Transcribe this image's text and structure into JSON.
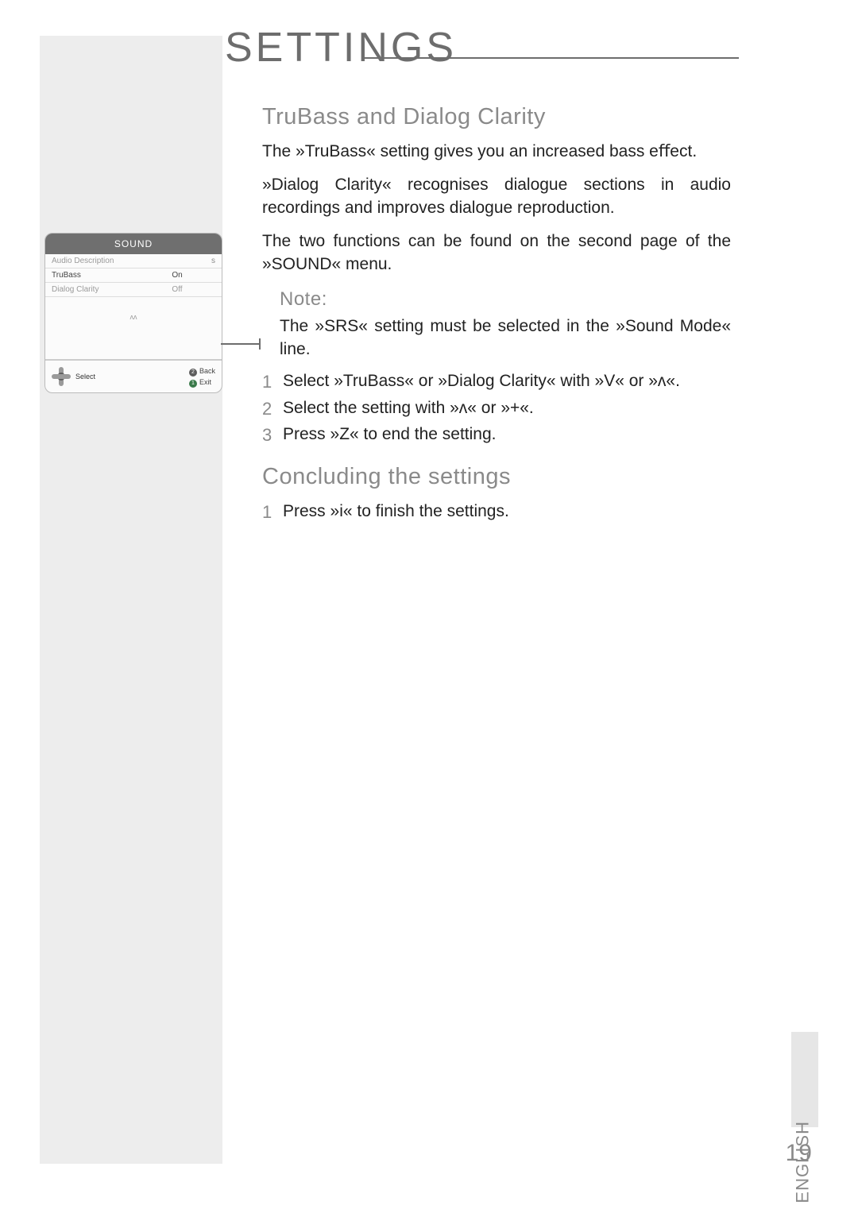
{
  "page_title": "SETTINGS",
  "section_heading": "TruBass and Dialog Clarity",
  "paragraphs": {
    "p1": "The »TruBass« setting gives you an increased bass eﬀect.",
    "p2": "»Dialog Clarity« recognises dialogue sections in audio recordings and improves dialogue reproduction.",
    "p3": "The two functions can be found on the second page of the »SOUND« menu."
  },
  "note": {
    "label": "Note:",
    "text": "The »SRS« setting must be selected in the »Sound Mode« line."
  },
  "steps_a": [
    "Select »TruBass« or »Dialog Clarity« with »V« or »ᴧ«.",
    "Select the setting with »ᴧ« or »+«.",
    "Press »Z« to end the setting."
  ],
  "concluding_heading": "Concluding the settings",
  "steps_b": [
    "Press »i« to ﬁnish the settings."
  ],
  "osd": {
    "title": "SOUND",
    "rows": [
      {
        "label": "Audio Description",
        "value": "",
        "arrow": "s",
        "dim": true
      },
      {
        "label": "TruBass",
        "value": "On",
        "arrow": "",
        "dim": false
      },
      {
        "label": "Dialog Clarity",
        "value": "Off",
        "arrow": "",
        "dim": true
      }
    ],
    "page_indicator": "ᴧᴧ",
    "select": "Select",
    "back": "Back",
    "exit": "Exit",
    "badge_back": "2",
    "badge_exit": "1"
  },
  "language": "ENGLISH",
  "page_number": "19"
}
